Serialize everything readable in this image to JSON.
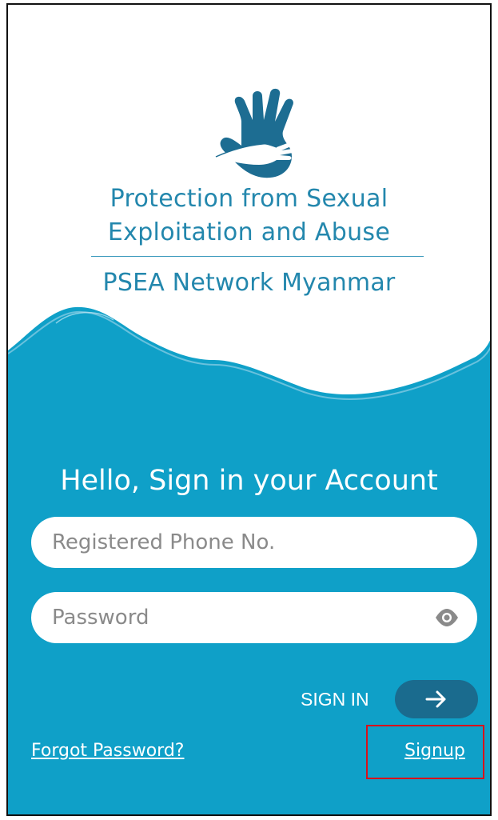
{
  "brand": {
    "line1": "Protection from Sexual",
    "line2": "Exploitation and Abuse",
    "network": "PSEA Network Myanmar",
    "logo_icon": "hands-icon",
    "primary_color": "#0fa0c8",
    "dark_color": "#1a6b8e"
  },
  "login": {
    "heading": "Hello, Sign in your Account",
    "phone_placeholder": "Registered Phone No.",
    "password_placeholder": "Password",
    "password_toggle_icon": "eye-icon",
    "signin_label": "SIGN IN",
    "signin_icon": "arrow-right-icon",
    "forgot_label": "Forgot Password?",
    "signup_label": "Signup"
  }
}
